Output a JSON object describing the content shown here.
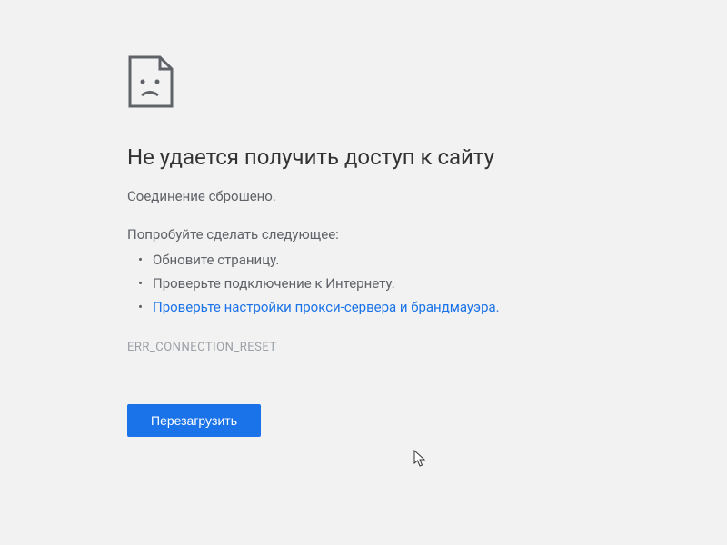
{
  "error": {
    "title": "Не удается получить доступ к сайту",
    "subtitle": "Соединение сброшено.",
    "suggestions_label": "Попробуйте сделать следующее:",
    "suggestions": [
      "Обновите страницу.",
      "Проверьте подключение к Интернету.",
      "Проверьте настройки прокси-сервера и брандмауэра."
    ],
    "error_code": "ERR_CONNECTION_RESET",
    "reload_button": "Перезагрузить"
  }
}
